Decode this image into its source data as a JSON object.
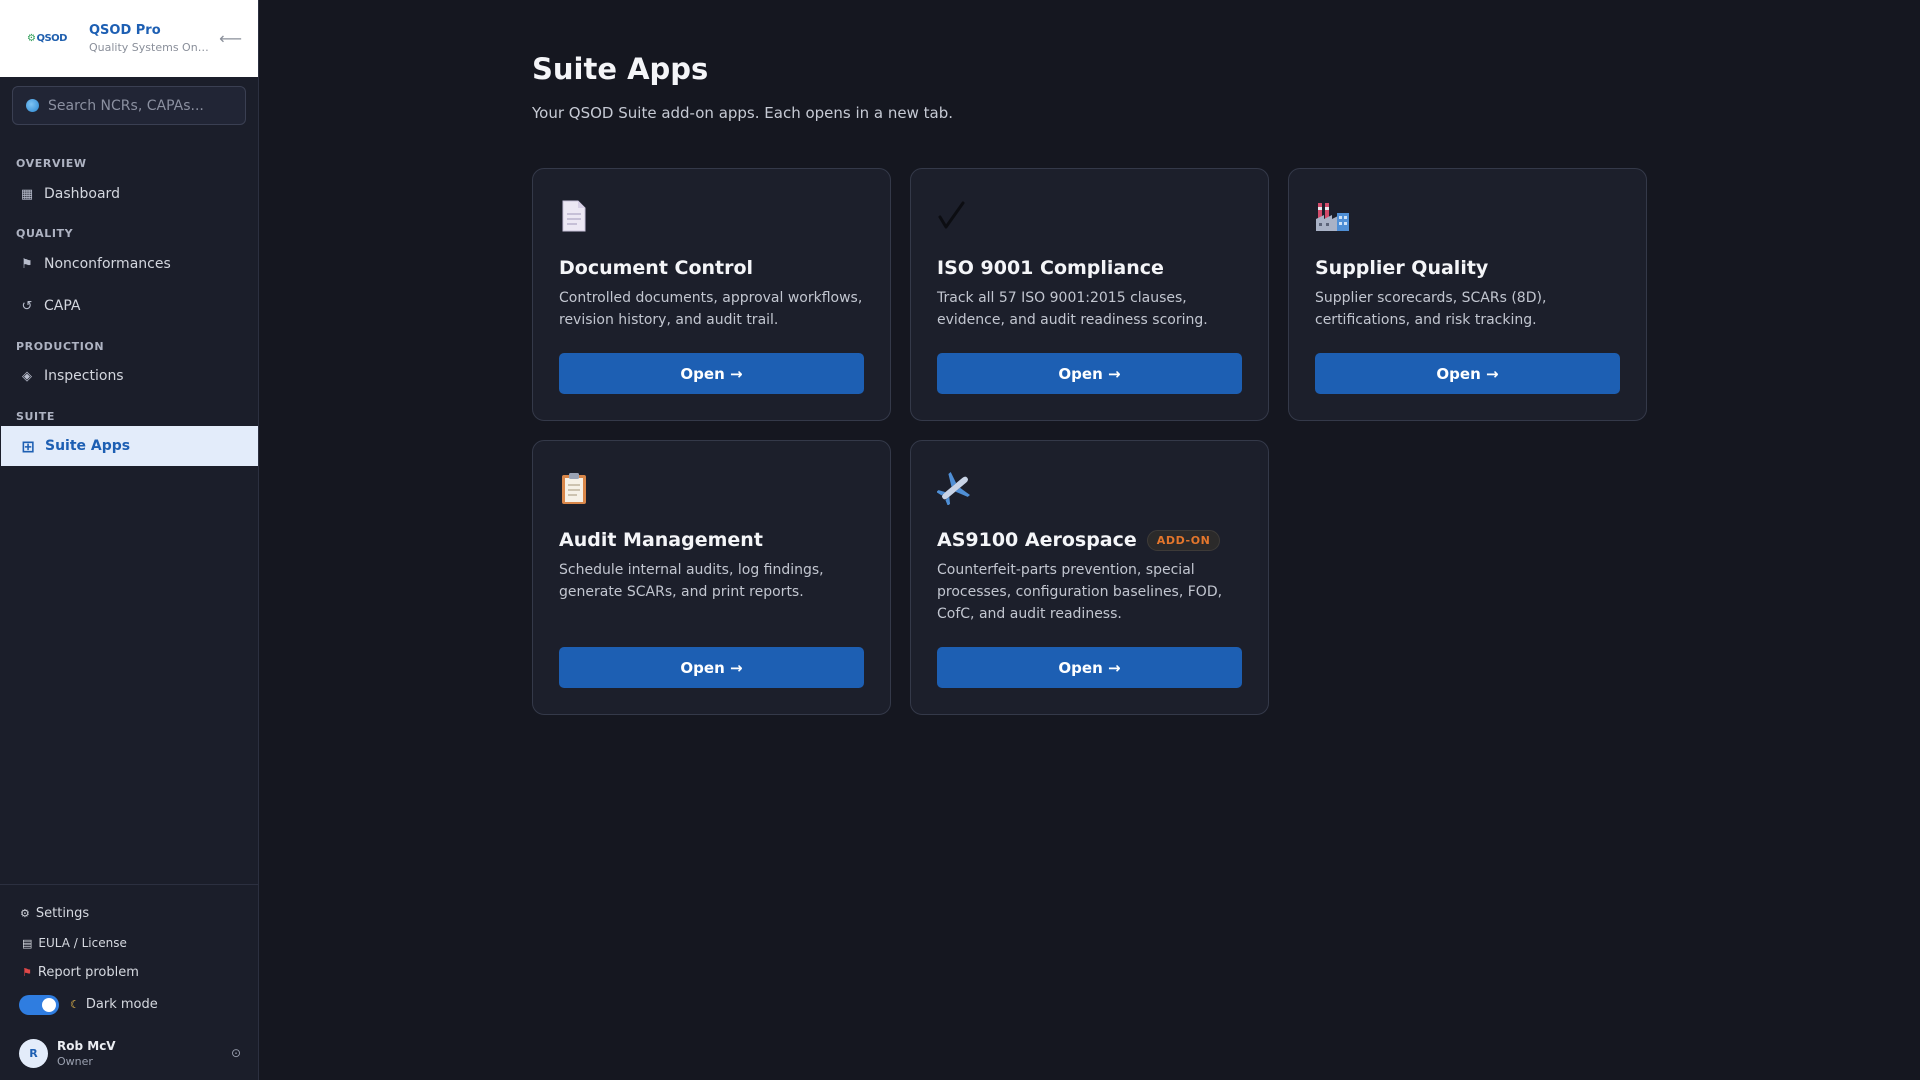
{
  "sidebar": {
    "brand": {
      "logo_text": "QSOD",
      "name": "QSOD Pro",
      "tagline": "Quality Systems On De..."
    },
    "search": {
      "placeholder": "Search NCRs, CAPAs..."
    },
    "sections": {
      "overview": "OVERVIEW",
      "quality": "QUALITY",
      "production": "PRODUCTION",
      "suite": "SUITE"
    },
    "items": {
      "dashboard": "Dashboard",
      "nonconformances": "Nonconformances",
      "capa": "CAPA",
      "inspections": "Inspections",
      "suite_apps": "Suite Apps"
    },
    "footer": {
      "settings": "Settings",
      "eula": "EULA / License",
      "report": "Report problem",
      "dark_mode": "Dark mode",
      "dark_mode_on": true,
      "user_initial": "R",
      "user_name": "Rob McV",
      "user_role": "Owner"
    }
  },
  "main": {
    "title": "Suite Apps",
    "subtitle": "Your QSOD Suite add-on apps. Each opens in a new tab.",
    "cards": [
      {
        "title": "Document Control",
        "icon": "document-icon",
        "description": "Controlled documents, approval workflows, revision history, and audit trail.",
        "button": "Open →"
      },
      {
        "title": "ISO 9001 Compliance",
        "icon": "checkmark-icon",
        "description": "Track all 57 ISO 9001:2015 clauses, evidence, and audit readiness scoring.",
        "button": "Open →"
      },
      {
        "title": "Supplier Quality",
        "icon": "factory-icon",
        "description": "Supplier scorecards, SCARs (8D), certifications, and risk tracking.",
        "button": "Open →"
      },
      {
        "title": "Audit Management",
        "icon": "clipboard-icon",
        "description": "Schedule internal audits, log findings, generate SCARs, and print reports.",
        "button": "Open →"
      },
      {
        "title": "AS9100 Aerospace",
        "icon": "airplane-icon",
        "badge": "ADD-ON",
        "description": "Counterfeit-parts prevention, special processes, configuration baselines, FOD, CofC, and audit readiness.",
        "button": "Open →"
      }
    ]
  },
  "colors": {
    "accent": "#1d5fb3",
    "background": "#151720",
    "card": "#1c1f2b",
    "badge": "#e4762c"
  }
}
